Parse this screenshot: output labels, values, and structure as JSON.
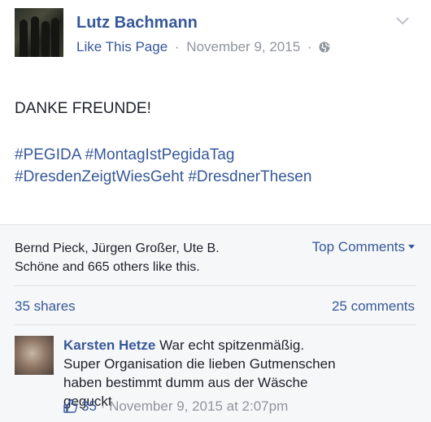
{
  "post": {
    "page_name": "Lutz Bachmann",
    "like_page_label": "Like This Page",
    "separator": "·",
    "date": "November 9, 2015",
    "privacy_icon": "globe-icon",
    "text": "DANKE FREUNDE!",
    "hashtags": [
      "#PEGIDA",
      "#MontagIstPegidaTag",
      "#DresdenZeigtWiesGeht",
      "#DresdnerThesen"
    ]
  },
  "footer": {
    "likes_line1": "Bernd Pieck, Jürgen Großer, Ute B.",
    "likes_line2": "Schöne and 665 others like this.",
    "top_comments_label": "Top Comments",
    "shares": "35 shares",
    "comments": "25 comments"
  },
  "comment": {
    "author": "Karsten Hetze",
    "text": "War echt spitzenmäßig. Super Organisation die lieben Gutmenschen haben bestimmt dumm aus der Wäsche geguckt",
    "likes": "35",
    "separator": "·",
    "time": "November 9, 2015 at 2:07pm",
    "like_icon": "thumbs-up-icon"
  },
  "colors": {
    "link": "#365899",
    "meta": "#90949c",
    "text": "#1d2129",
    "footer_bg": "#f6f7f9"
  }
}
